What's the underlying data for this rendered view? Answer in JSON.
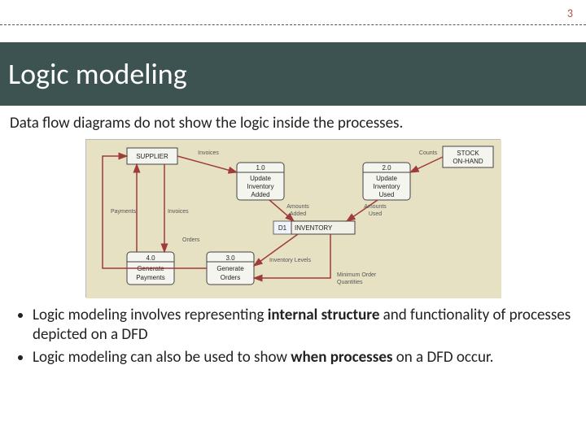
{
  "page_number": "3",
  "title": "Logic modeling",
  "intro": "Data flow diagrams do not show the logic inside the processes.",
  "bullets": [
    {
      "pre": "Logic modeling involves representing ",
      "strong": "internal structure",
      "post": " and functionality of processes depicted on a DFD"
    },
    {
      "pre": "Logic modeling can also be used to show ",
      "strong": "when processes",
      "post": " on a DFD occur."
    }
  ],
  "diagram": {
    "ext_supplier": "SUPPLIER",
    "ext_stock1": "STOCK",
    "ext_stock2": "ON-HAND",
    "p1_num": "1.0",
    "p1_l1": "Update",
    "p1_l2": "Inventory",
    "p1_l3": "Added",
    "p2_num": "2.0",
    "p2_l1": "Update",
    "p2_l2": "Inventory",
    "p2_l3": "Used",
    "p3_num": "3.0",
    "p3_l1": "Generate",
    "p3_l2": "Orders",
    "p4_num": "4.0",
    "p4_l1": "Generate",
    "p4_l2": "Payments",
    "ds_id": "D1",
    "ds_name": "INVENTORY",
    "fl_invoices": "Invoices",
    "fl_counts": "Counts",
    "fl_amt_added": "Amounts",
    "fl_amt_added2": "Added",
    "fl_amt_used": "Amounts",
    "fl_amt_used2": "Used",
    "fl_payments": "Payments",
    "fl_invoices2": "Invoices",
    "fl_orders": "Orders",
    "fl_inv_levels": "Inventory Levels",
    "fl_min_order1": "Minimum Order",
    "fl_min_order2": "Quantities"
  }
}
